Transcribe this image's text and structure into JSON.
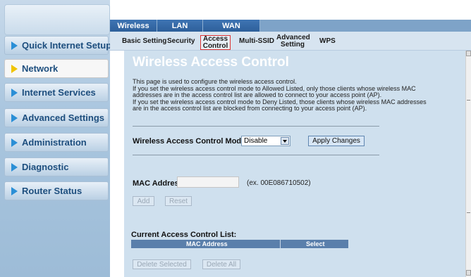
{
  "sidebar": {
    "items": [
      {
        "label": "Quick Internet Setup"
      },
      {
        "label": "Network"
      },
      {
        "label": "Internet Services"
      },
      {
        "label": "Advanced Settings"
      },
      {
        "label": "Administration"
      },
      {
        "label": "Diagnostic"
      },
      {
        "label": "Router Status"
      }
    ],
    "active_index": 1
  },
  "top_tabs": [
    {
      "label": "Wireless"
    },
    {
      "label": "LAN"
    },
    {
      "label": "WAN"
    }
  ],
  "sub_tabs": [
    {
      "label": "Basic Setting"
    },
    {
      "label": "Security"
    },
    {
      "label": "Access Control",
      "line1": "Access",
      "line2": "Control",
      "selected": true
    },
    {
      "label": "Multi-SSID"
    },
    {
      "label": "Advanced Setting",
      "line1": "Advanced",
      "line2": "Setting"
    },
    {
      "label": "WPS"
    }
  ],
  "page": {
    "title": "Wireless Access Control",
    "description": [
      "This page is used to configure the wireless access control.",
      "If you set the wireless access control mode to Allowed Listed, only those clients whose wireless MAC",
      "addresses are in the access control list are allowed to connect to your access point (AP).",
      "If you set the wireless access control mode to Deny Listed, those clients whose wireless MAC addresses",
      "are in the access control list are blocked from connecting to your access point (AP)."
    ],
    "mode_label": "Wireless Access Control Mode:",
    "mode_value": "Disable",
    "apply_button": "Apply Changes",
    "mac_label": "MAC Address:",
    "mac_value": "",
    "mac_hint": "(ex. 00E086710502)",
    "add_button": "Add",
    "reset_button": "Reset",
    "list_title": "Current Access Control List:",
    "list_columns": [
      "MAC Address",
      "Select"
    ],
    "delete_selected_button": "Delete Selected",
    "delete_all_button": "Delete All"
  },
  "colors": {
    "accent": "#2d5f9a",
    "content_bg": "#cfe0ee",
    "selected_outline": "#dd3333"
  }
}
